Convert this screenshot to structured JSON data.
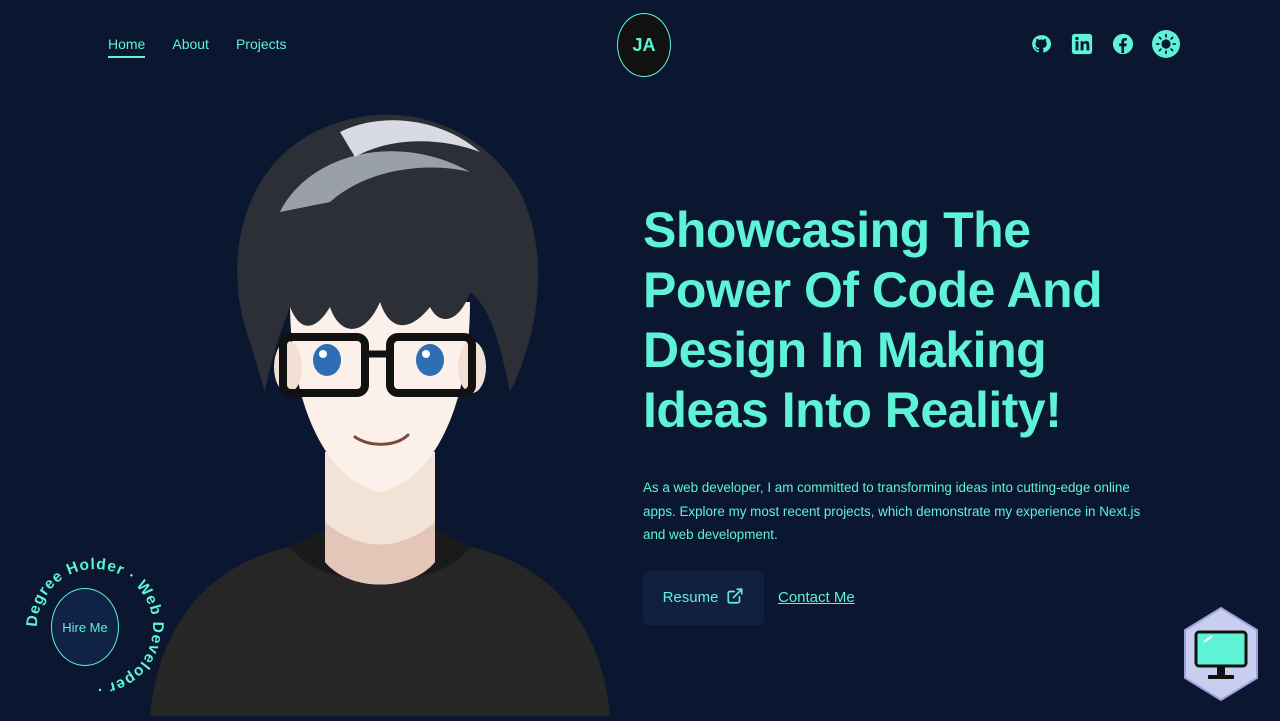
{
  "nav": {
    "links": [
      {
        "label": "Home"
      },
      {
        "label": "About"
      },
      {
        "label": "Projects"
      }
    ],
    "logo_text": "JA",
    "social_icons": [
      "github-icon",
      "linkedin-icon",
      "facebook-icon",
      "theme-toggle-icon"
    ]
  },
  "hero": {
    "title": "Showcasing The Power Of Code And Design In Making Ideas Into Reality!",
    "description": "As a web developer, I am committed to transforming ideas into cutting-edge online apps. Explore my most recent projects, which demonstrate my experience in Next.js and web development.",
    "resume_label": "Resume",
    "contact_label": "Contact Me"
  },
  "hire": {
    "button_label": "Hire Me",
    "ring_text": "Degree Holder · Web Developer · "
  },
  "colors": {
    "background": "#0b1730",
    "accent": "#5ef2d6",
    "button_bg": "#111f40"
  }
}
